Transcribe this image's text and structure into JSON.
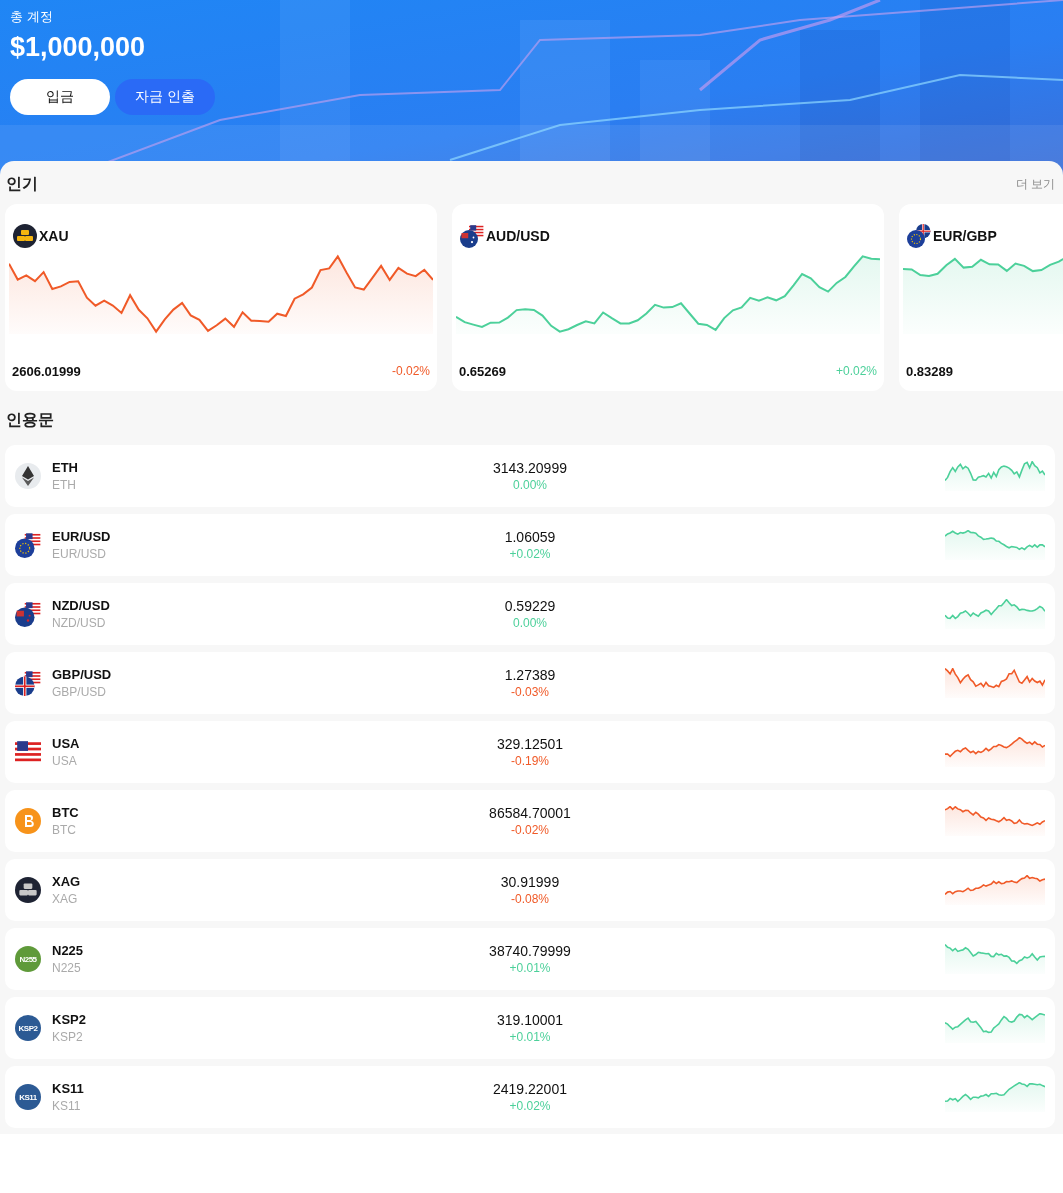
{
  "account": {
    "label": "총 계정",
    "balance": "$1,000,000",
    "buttons": [
      {
        "label": "입금",
        "kind": "light"
      },
      {
        "label": "자금 인출",
        "kind": "primary"
      }
    ]
  },
  "popular": {
    "title": "인기",
    "more": "더 보기",
    "cards": [
      {
        "symbol": "XAU",
        "icon": {
          "kind": "gold"
        },
        "price": "2606.01999",
        "change": "-0.02%",
        "rising": false
      },
      {
        "symbol": "AUD/USD",
        "icon": {
          "kind": "au_us"
        },
        "price": "0.65269",
        "change": "+0.02%",
        "rising": true
      },
      {
        "symbol": "EUR/GBP",
        "icon": {
          "kind": "eu_gb"
        },
        "price": "0.83289",
        "rising": true
      }
    ]
  },
  "quotes": {
    "title": "인용문",
    "rows": [
      {
        "symbol": "ETH",
        "sub": "ETH",
        "icon": {
          "kind": "eth"
        },
        "price": "3143.20999",
        "change": "0.00%",
        "rising": true
      },
      {
        "symbol": "EUR/USD",
        "sub": "EUR/USD",
        "icon": {
          "kind": "eu_us"
        },
        "price": "1.06059",
        "change": "+0.02%",
        "rising": true
      },
      {
        "symbol": "NZD/USD",
        "sub": "NZD/USD",
        "icon": {
          "kind": "nz_us"
        },
        "price": "0.59229",
        "change": "0.00%",
        "rising": true
      },
      {
        "symbol": "GBP/USD",
        "sub": "GBP/USD",
        "icon": {
          "kind": "gb_us"
        },
        "price": "1.27389",
        "change": "-0.03%",
        "rising": false
      },
      {
        "symbol": "USA",
        "sub": "USA",
        "icon": {
          "kind": "us"
        },
        "price": "329.12501",
        "change": "-0.19%",
        "rising": false
      },
      {
        "symbol": "BTC",
        "sub": "BTC",
        "icon": {
          "kind": "btc"
        },
        "price": "86584.70001",
        "change": "-0.02%",
        "rising": false
      },
      {
        "symbol": "XAG",
        "sub": "XAG",
        "icon": {
          "kind": "silver"
        },
        "price": "30.91999",
        "change": "-0.08%",
        "rising": false
      },
      {
        "symbol": "N225",
        "sub": "N225",
        "icon": {
          "kind": "badge",
          "text": "N255",
          "color": "#5f9a3a"
        },
        "price": "38740.79999",
        "change": "+0.01%",
        "rising": true
      },
      {
        "symbol": "KSP2",
        "sub": "KSP2",
        "icon": {
          "kind": "badge",
          "text": "KSP2",
          "color": "#2c5a94"
        },
        "price": "319.10001",
        "change": "+0.01%",
        "rising": true
      },
      {
        "symbol": "KS11",
        "sub": "KS11",
        "icon": {
          "kind": "badge",
          "text": "KS11",
          "color": "#2c5a94"
        },
        "price": "2419.22001",
        "change": "+0.02%",
        "rising": true
      }
    ]
  }
}
